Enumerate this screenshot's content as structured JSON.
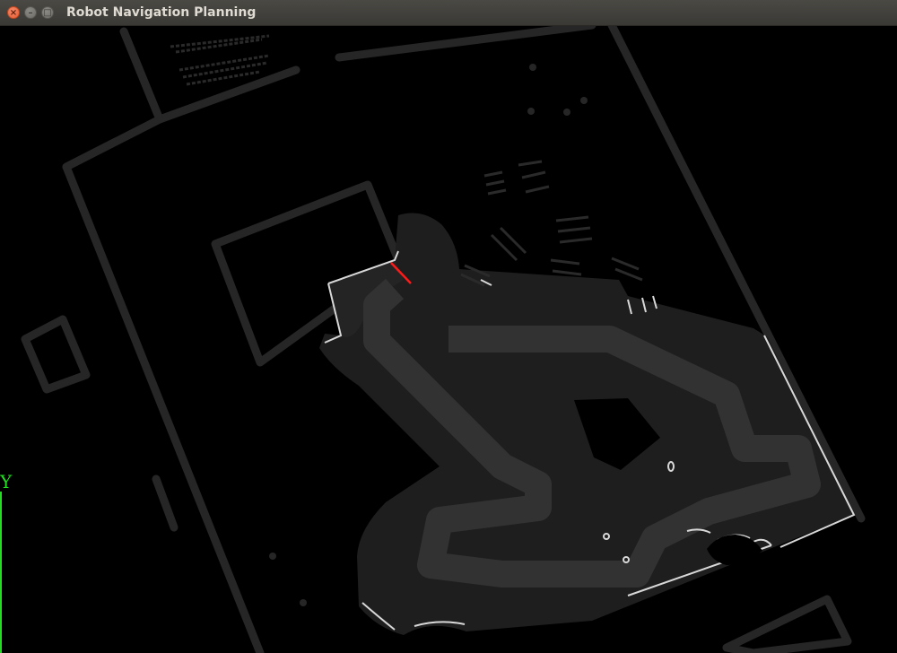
{
  "window": {
    "title": "Robot Navigation Planning",
    "controls": [
      "close",
      "minimize",
      "maximize"
    ]
  },
  "view": {
    "axis_label": "Y",
    "colors": {
      "background": "#000000",
      "static_map": "#262626",
      "free_space": "#1e1e1e",
      "costmap_path": "#323232",
      "obstacle_edges": "#d8d8d8",
      "robot_heading": "#ff1a1a",
      "axis": "#22dd22"
    }
  }
}
